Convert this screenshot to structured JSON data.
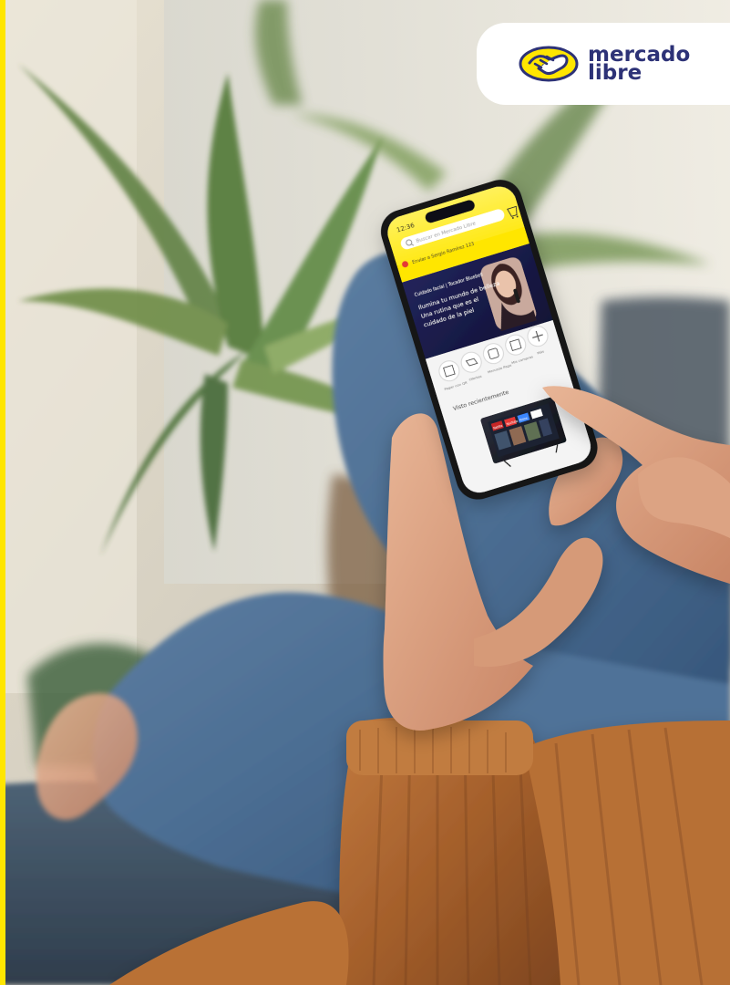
{
  "brand": {
    "line1": "mercado",
    "line2": "libre",
    "colors": {
      "yellow": "#ffe600",
      "navy": "#2d3277"
    }
  },
  "phone_screen": {
    "status_time": "12:36",
    "search_placeholder": "Buscar en Mercado Libre",
    "address_text": "Enviar a Sergio Ramírez 123",
    "banner_heading": "Cuidado facial | Tocador Bluebell",
    "banner_copy": [
      "Ilumina tu mundo de belleza",
      "Una rutina que es el",
      "cuidado de la piel"
    ],
    "icon_labels": [
      "Pagar con QR",
      "Ofertas",
      "Mercado Pago",
      "Mis compras",
      "Más"
    ],
    "section_title": "Visto recientemente",
    "tv_apps": [
      "Netflix",
      "YouTube",
      "Prime"
    ]
  },
  "icons": [
    "handshake-icon",
    "search-icon",
    "cart-icon",
    "location-icon",
    "qr-icon",
    "tag-icon",
    "wallet-icon",
    "box-icon",
    "plus-icon"
  ]
}
